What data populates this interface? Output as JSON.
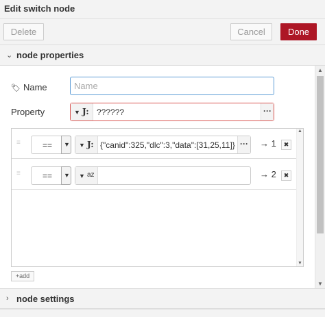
{
  "dialog": {
    "title": "Edit switch node"
  },
  "toolbar": {
    "delete_label": "Delete",
    "cancel_label": "Cancel",
    "done_label": "Done"
  },
  "sections": {
    "properties_label": "node properties",
    "settings_label": "node settings"
  },
  "form": {
    "name_label": "Name",
    "name_placeholder": "Name",
    "name_value": "",
    "property_label": "Property",
    "property_type_icon": "J:",
    "property_value": "??????"
  },
  "rules": [
    {
      "operator": "==",
      "type_icon": "J:",
      "value": "{\"canid\":325,\"dlc\":3,\"data\":[31,25,11]}",
      "output": "→ 1"
    },
    {
      "operator": "==",
      "type_icon": "az",
      "value": "",
      "output": "→ 2"
    }
  ],
  "add_label": "add",
  "icons": {
    "section_open": "chevron-down-icon",
    "section_closed": "chevron-right-icon",
    "tag": "tag-icon",
    "remove": "close-icon"
  },
  "colors": {
    "done_button": "#ad1625",
    "focus_border": "#5b9bd5",
    "error_border": "#d9534f"
  }
}
